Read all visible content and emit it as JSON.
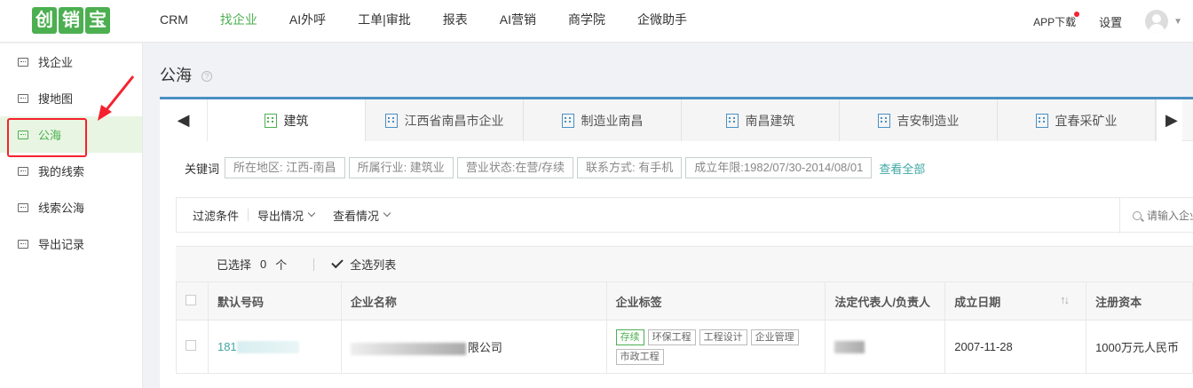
{
  "logo": {
    "chars": [
      "创",
      "销",
      "宝"
    ]
  },
  "nav": {
    "items": [
      {
        "label": "CRM",
        "active": false
      },
      {
        "label": "找企业",
        "active": true
      },
      {
        "label": "AI外呼",
        "active": false
      },
      {
        "label": "工单|审批",
        "active": false
      },
      {
        "label": "报表",
        "active": false
      },
      {
        "label": "AI营销",
        "active": false
      },
      {
        "label": "商学院",
        "active": false
      },
      {
        "label": "企微助手",
        "active": false
      }
    ],
    "app_download": "APP下载",
    "settings": "设置"
  },
  "sidebar": {
    "items": [
      {
        "label": "找企业"
      },
      {
        "label": "搜地图"
      },
      {
        "label": "公海"
      },
      {
        "label": "我的线索"
      },
      {
        "label": "线索公海"
      },
      {
        "label": "导出记录"
      }
    ],
    "active_index": 2
  },
  "page": {
    "title": "公海",
    "help": "?"
  },
  "tabs": {
    "items": [
      {
        "label": "建筑"
      },
      {
        "label": "江西省南昌市企业"
      },
      {
        "label": "制造业南昌"
      },
      {
        "label": "南昌建筑"
      },
      {
        "label": "吉安制造业"
      },
      {
        "label": "宜春采矿业"
      }
    ],
    "active_index": 0
  },
  "keywords": {
    "label": "关键词",
    "tags": [
      "所在地区: 江西-南昌",
      "所属行业: 建筑业",
      "营业状态:在营/存续",
      "联系方式: 有手机",
      "成立年限:1982/07/30-2014/08/01"
    ],
    "view_all": "查看全部"
  },
  "toolbar": {
    "filter": "过滤条件",
    "export": "导出情况",
    "view": "查看情况",
    "search_placeholder": "请输入企业"
  },
  "selection": {
    "selected_label": "已选择",
    "count": "0",
    "unit": "个",
    "select_all": "全选列表"
  },
  "table": {
    "headers": [
      "默认号码",
      "企业名称",
      "企业标签",
      "法定代表人/负责人",
      "成立日期",
      "注册资本"
    ],
    "rows": [
      {
        "phone_prefix": "181",
        "company_suffix": "限公司",
        "tags": [
          {
            "label": "存续",
            "green": true
          },
          {
            "label": "环保工程",
            "green": false
          },
          {
            "label": "工程设计",
            "green": false
          },
          {
            "label": "企业管理",
            "green": false
          },
          {
            "label": "市政工程",
            "green": false
          }
        ],
        "legal_rep": "",
        "established": "2007-11-28",
        "capital": "1000万元人民币"
      }
    ]
  },
  "colors": {
    "accent_green": "#4caf50",
    "tab_blue": "#4a90c4",
    "link_teal": "#3fa7a3",
    "annotation_red": "#f5222d"
  }
}
